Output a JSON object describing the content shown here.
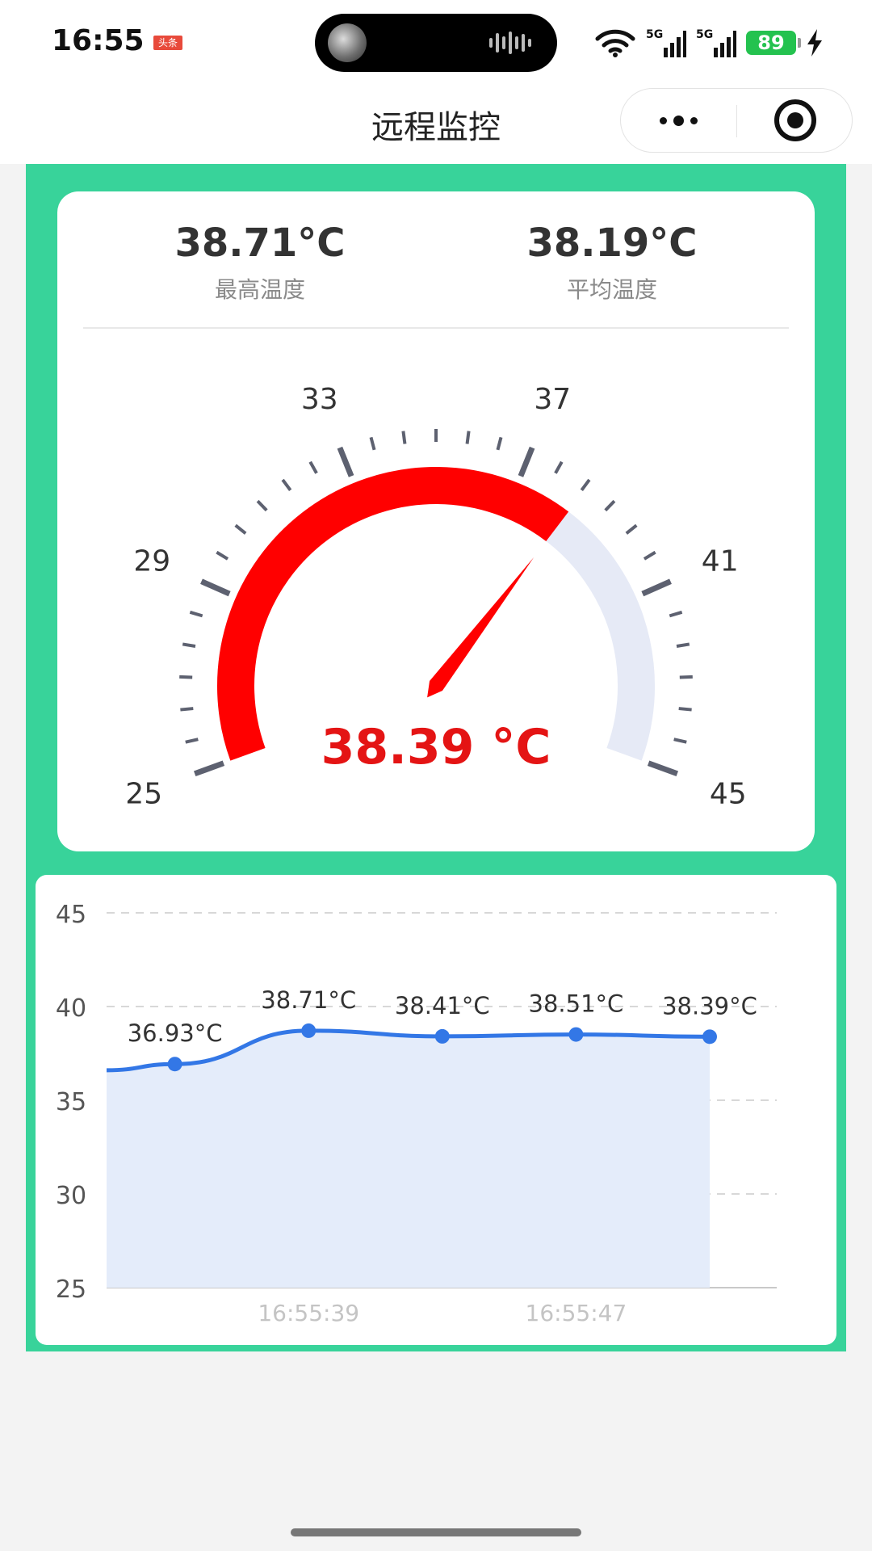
{
  "status_bar": {
    "time": "16:55",
    "app_badge": "头条",
    "signal_1": "5G",
    "signal_2": "5G",
    "battery": "89",
    "icons": [
      "wifi-icon",
      "signal-5g-icon",
      "signal-5g-icon",
      "battery-icon",
      "charging-icon"
    ]
  },
  "nav": {
    "title": "远程监控",
    "icons": [
      "more-icon",
      "close-mini-program-icon"
    ]
  },
  "stats": {
    "max_value": "38.71°C",
    "max_label": "最高温度",
    "avg_value": "38.19°C",
    "avg_label": "平均温度"
  },
  "gauge": {
    "min": 25,
    "max": 45,
    "value": 38.39,
    "value_text": "38.39 °C",
    "tick_labels": [
      "25",
      "29",
      "33",
      "37",
      "41",
      "45"
    ],
    "colors": {
      "progress": "#ff0000",
      "track": "#e6eaf6",
      "ticks": "#5d6170",
      "value": "#e41414"
    }
  },
  "chart_data": {
    "type": "area",
    "x_ticks": [
      "",
      "16:55:39",
      "",
      "16:55:47",
      ""
    ],
    "values": [
      36.6,
      36.93,
      38.71,
      38.41,
      38.51,
      38.39
    ],
    "data_labels": [
      "",
      "36.93°C",
      "38.71°C",
      "38.41°C",
      "38.51°C",
      "38.39°C"
    ],
    "yticks": [
      "25",
      "30",
      "35",
      "40",
      "45"
    ],
    "ylim": [
      25,
      45
    ],
    "grid": true,
    "colors": {
      "line": "#3377e6",
      "fill": "#e4ecfa",
      "grid": "#d8d8d8"
    }
  }
}
